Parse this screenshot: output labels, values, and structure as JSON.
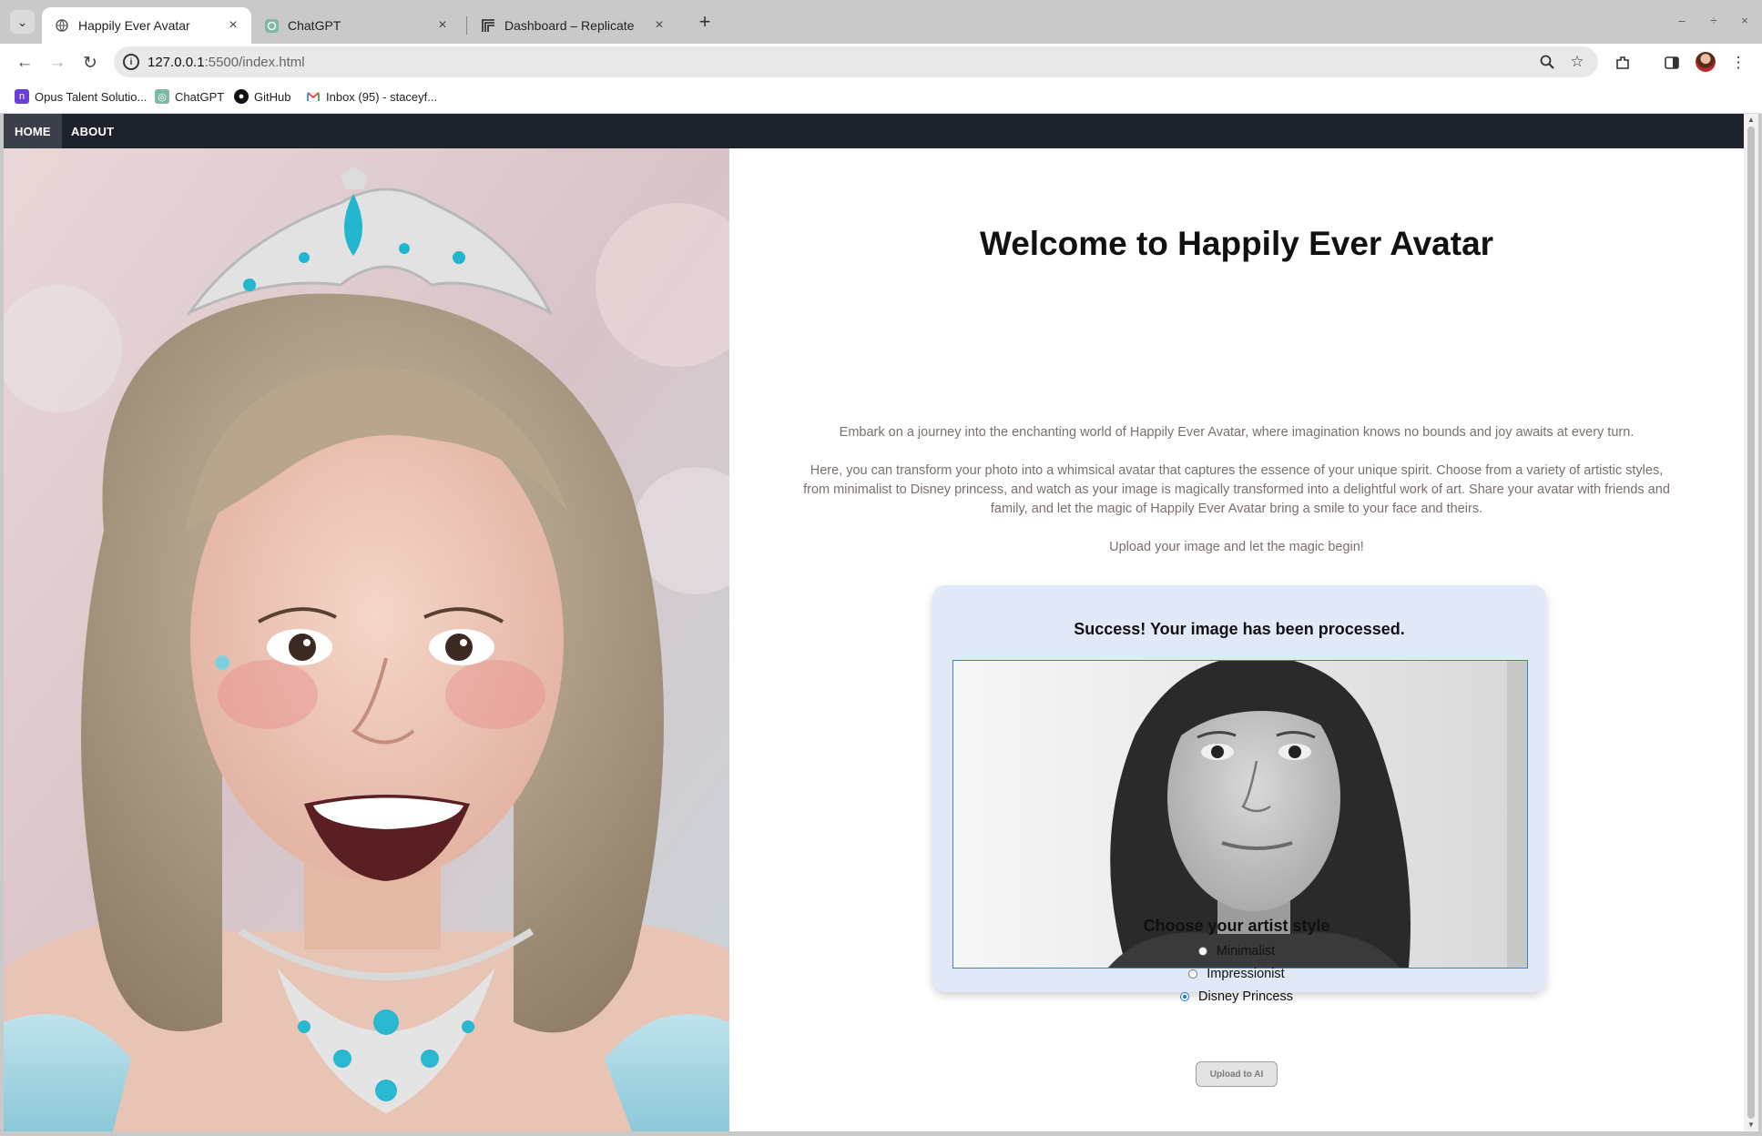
{
  "browser": {
    "tabs": [
      {
        "title": "Happily Ever Avatar",
        "active": true,
        "icon": "globe-icon"
      },
      {
        "title": "ChatGPT",
        "active": false,
        "icon": "chatgpt-icon"
      },
      {
        "title": "Dashboard – Replicate",
        "active": false,
        "icon": "replicate-icon"
      }
    ],
    "url_host": "127.0.0.1",
    "url_path": ":5500/index.html",
    "bookmarks": [
      {
        "label": "Opus Talent Solutio...",
        "icon": "opus-icon"
      },
      {
        "label": "ChatGPT",
        "icon": "chatgpt-icon"
      },
      {
        "label": "GitHub",
        "icon": "github-icon"
      },
      {
        "label": "Inbox (95) - staceyf...",
        "icon": "gmail-icon"
      }
    ]
  },
  "nav": {
    "home": "HOME",
    "about": "ABOUT"
  },
  "main": {
    "title": "Welcome to Happily Ever Avatar",
    "intro_1": "Embark on a journey into the enchanting world of Happily Ever Avatar, where imagination knows no bounds and joy awaits at every turn.",
    "intro_2": "Here, you can transform your photo into a whimsical avatar that captures the essence of your unique spirit. Choose from a variety of artistic styles, from minimalist to Disney princess, and watch as your image is magically transformed into a delightful work of art. Share your avatar with friends and family, and let the magic of Happily Ever Avatar bring a smile to your face and theirs.",
    "intro_3": "Upload your image and let the magic begin!",
    "result_title": "Success! Your image has been processed.",
    "style_title": "Choose your artist style",
    "styles": [
      {
        "label": "Minimalist",
        "checked": false
      },
      {
        "label": "Impressionist",
        "checked": false
      },
      {
        "label": "Disney Princess",
        "checked": true
      }
    ],
    "upload_label": "Upload to AI"
  },
  "colors": {
    "nav_bg": "#1e222b",
    "card_bg": "#e1e8f8",
    "accent": "#1a73e8",
    "intro_text": "#7c6e6a"
  }
}
